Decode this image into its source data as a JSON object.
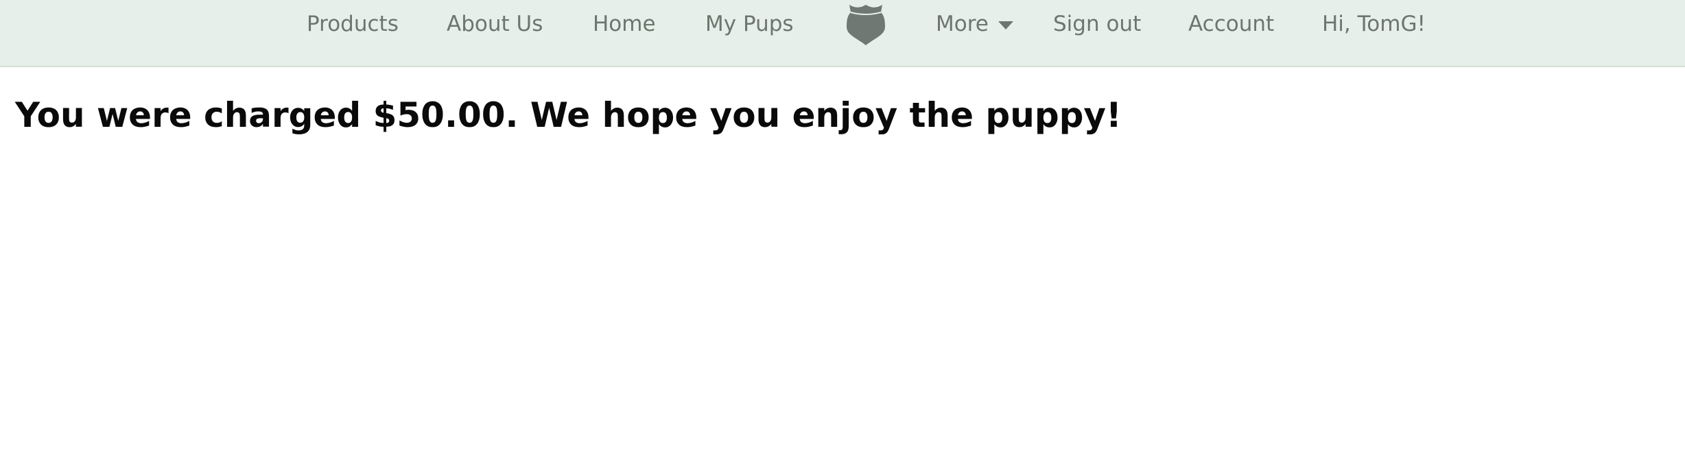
{
  "nav": {
    "items": [
      {
        "label": "Products"
      },
      {
        "label": "About Us"
      },
      {
        "label": "Home"
      },
      {
        "label": "My Pups"
      }
    ],
    "logo_icon": "shield-logo-icon",
    "more_label": "More",
    "more_icon": "caret-down-icon",
    "sign_out_label": "Sign out",
    "account_label": "Account",
    "greeting": "Hi, TomG!"
  },
  "main": {
    "message": "You were charged $50.00. We hope you enjoy the puppy!"
  },
  "colors": {
    "navbar_bg": "#e6efea",
    "nav_text": "#6d756f",
    "logo": "#6f7872",
    "message_text": "#0a0a0a"
  }
}
